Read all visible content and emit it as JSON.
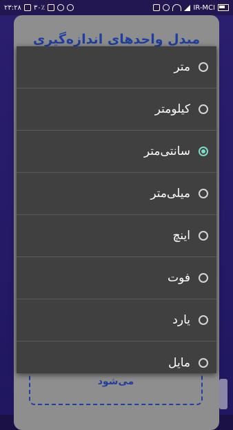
{
  "status_bar": {
    "time": "۲۳:۲۸",
    "battery": "۳۰٪",
    "carrier": "IR-MCI"
  },
  "app": {
    "title": "مبدل واحدهای اندازه‌گیری",
    "bottom_text": "می‌شود"
  },
  "dialog": {
    "options": [
      {
        "label": "متر",
        "selected": false
      },
      {
        "label": "کیلومتر",
        "selected": false
      },
      {
        "label": "سانتی‌متر",
        "selected": true
      },
      {
        "label": "میلی‌متر",
        "selected": false
      },
      {
        "label": "اینچ",
        "selected": false
      },
      {
        "label": "فوت",
        "selected": false
      },
      {
        "label": "یارد",
        "selected": false
      },
      {
        "label": "مایل",
        "selected": false
      }
    ]
  },
  "colors": {
    "accent": "#7fd9c6",
    "dialog_bg": "#404040",
    "title": "#1f3f9e"
  }
}
